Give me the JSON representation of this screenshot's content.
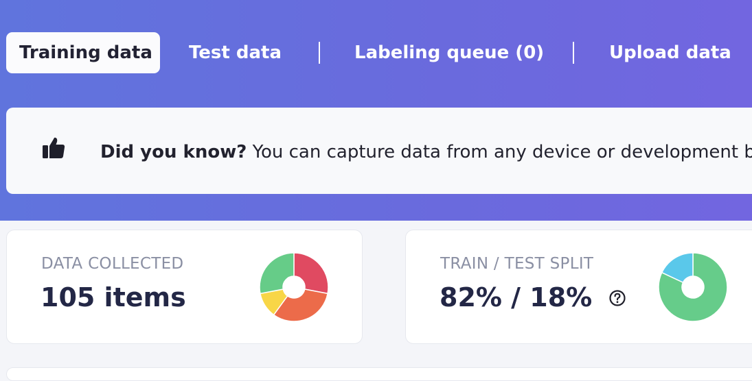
{
  "tabs": [
    {
      "label": "Training data",
      "active": true
    },
    {
      "label": "Test data",
      "active": false
    },
    {
      "label": "Labeling queue (0)",
      "active": false
    },
    {
      "label": "Upload data",
      "active": false
    }
  ],
  "banner": {
    "icon": "thumbs-up-icon",
    "heading": "Did you know?",
    "text": "You can capture data from any device or development bo"
  },
  "cards": {
    "data_collected": {
      "label": "DATA COLLECTED",
      "value": "105 items"
    },
    "train_test_split": {
      "label": "TRAIN / TEST SPLIT",
      "value": "82% / 18%",
      "help_icon": "question-circle-icon"
    }
  },
  "chart_data": [
    {
      "type": "pie",
      "values": [
        28,
        32,
        12,
        28
      ],
      "colors": [
        "#e04a61",
        "#ec6b4a",
        "#f8d647",
        "#66cc88"
      ],
      "donut": true
    },
    {
      "type": "pie",
      "values": [
        82,
        18
      ],
      "colors": [
        "#66cc8a",
        "#5ac8ea"
      ],
      "donut": true
    }
  ]
}
